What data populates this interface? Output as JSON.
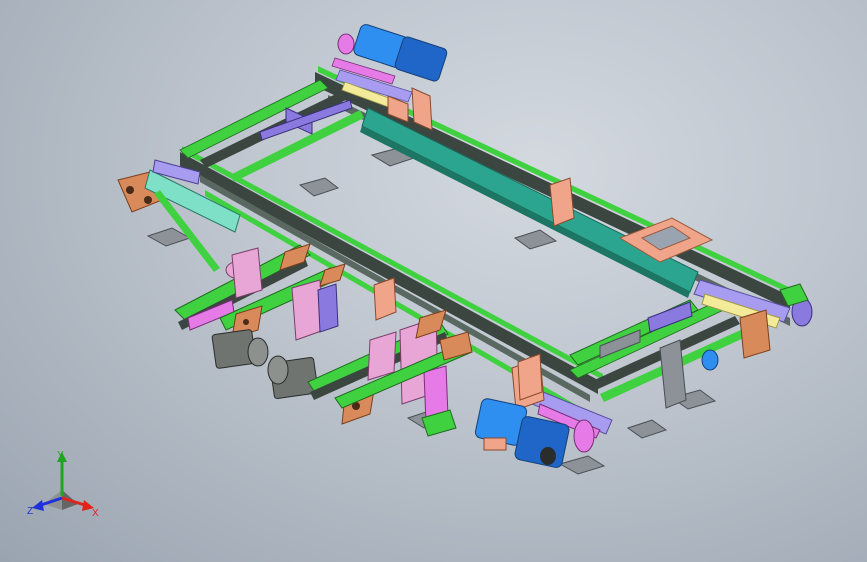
{
  "viewport": {
    "background_top": "#d4d9e0",
    "background_bottom": "#9aa4b0"
  },
  "triad": {
    "x_label": "X",
    "y_label": "Y",
    "z_label": "Z",
    "x_color": "#e0241c",
    "y_color": "#1fa51f",
    "z_color": "#2030d8"
  },
  "model": {
    "colors": {
      "frame_green": "#3fd13f",
      "rail_dark": "#3c4640",
      "belt_teal": "#2ba58f",
      "motor_blue": "#2f8ff0",
      "motor_dark": "#1f4f9a",
      "roller_lavender": "#a89cf0",
      "roller_pink": "#e67ae6",
      "bracket_orange": "#d98a5a",
      "plate_salmon": "#f0a58a",
      "plate_pink": "#e8a6d6",
      "support_gray": "#8c9298",
      "gearbox_gray": "#6f7470"
    }
  }
}
